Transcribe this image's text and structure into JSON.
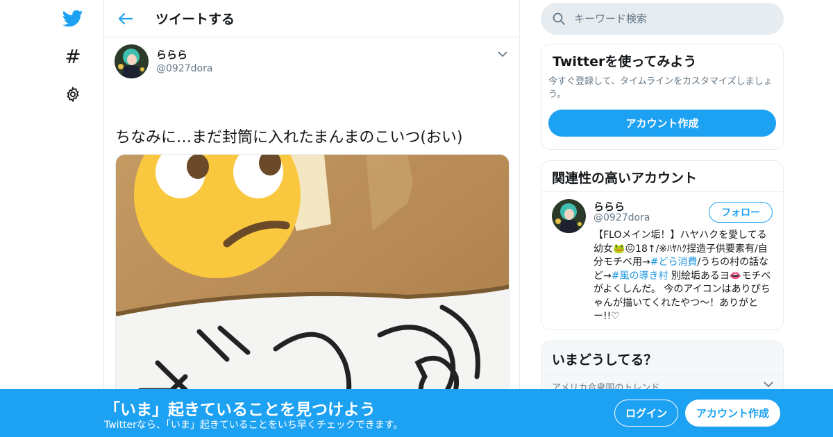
{
  "colors": {
    "accent": "#1da1f2",
    "text": "#14171a",
    "secondary": "#657786",
    "border": "#e6ecf0",
    "link": "#1b95e0"
  },
  "nav": {
    "icons": [
      "twitter-bird-icon",
      "hashtag-icon",
      "gear-icon"
    ],
    "hashtag_glyph": "#"
  },
  "header": {
    "title": "ツイートする"
  },
  "tweet": {
    "author_name": "ららら",
    "author_handle": "@0927dora",
    "text": "ちなみに…まだ封筒に入れたまんまのこいつ(おい)",
    "photo_emoji": "face-with-rolling-eyes"
  },
  "search": {
    "placeholder": "キーワード検索"
  },
  "signup_card": {
    "title": "Twitterを使ってみよう",
    "description": "今すぐ登録して、タイムラインをカスタマイズしましょう。",
    "button": "アカウント作成"
  },
  "related": {
    "title": "関連性の高いアカウント",
    "name": "ららら",
    "handle": "@0927dora",
    "follow": "フォロー",
    "bio_1": "【FLOメイン垢！】ハヤハクを愛してる幼女",
    "bio_emoji_1": "🐸",
    "bio_emoji_2": "😖",
    "bio_2": "18↑/※ﾊﾔﾊｸ捏造子供要素有/自分モチベ用→",
    "tag_1": "#どら消費",
    "bio_3": "/うちの村の話など→",
    "tag_2": "#風の導き村",
    "bio_4": " 別絵垢あるヨ",
    "bio_emoji_3": "👄",
    "bio_5": "モチベがよくしんだ。 今のアイコンはありぴちゃんが描いてくれたやつ〜！ありがとー!!♡"
  },
  "trends": {
    "title": "いまどうしてる？",
    "location": "アメリカ合衆国のトレンド"
  },
  "banner": {
    "title": "「いま」起きていることを見つけよう",
    "subtitle": "Twitterなら、「いま」起きていることをいち早くチェックできます。",
    "login": "ログイン",
    "signup": "アカウント作成"
  }
}
